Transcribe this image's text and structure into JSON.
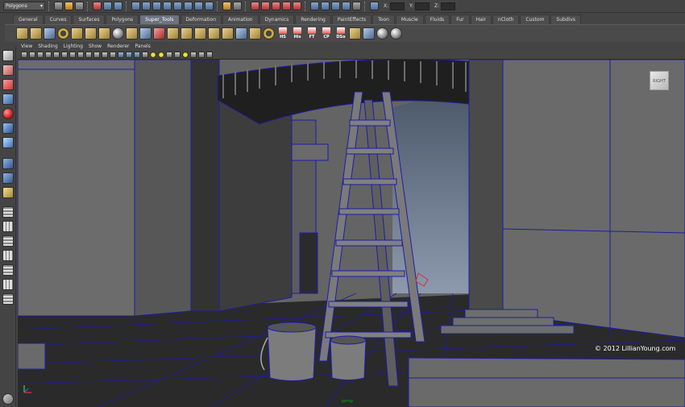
{
  "status_line": {
    "menu_set": "Polygons",
    "x_label": "X:",
    "y_label": "Y:",
    "z_label": "Z:"
  },
  "shelf_tabs": [
    "General",
    "Curves",
    "Surfaces",
    "Polygons",
    "Super_Tools",
    "Deformation",
    "Animation",
    "Dynamics",
    "Rendering",
    "PaintEffects",
    "Toon",
    "Muscle",
    "Fluids",
    "Fur",
    "Hair",
    "nCloth",
    "Custom",
    "Subdivs"
  ],
  "active_shelf_tab": "Super_Tools",
  "shelf_labels": {
    "hs": "HS",
    "his": "His",
    "ft": "FT",
    "cp": "CP",
    "dso": "DSo"
  },
  "panel_menu": [
    "View",
    "Shading",
    "Lighting",
    "Show",
    "Renderer",
    "Panels"
  ],
  "viewport": {
    "viewcube_label": "RIGHT",
    "copyright": "© 2012 LillianYoung.com",
    "camera": "persp"
  },
  "colors": {
    "ui_bg": "#444444",
    "viewport_bg": "#646464",
    "wireframe": "#1c1ca8",
    "active_tab": "#6b7280"
  }
}
